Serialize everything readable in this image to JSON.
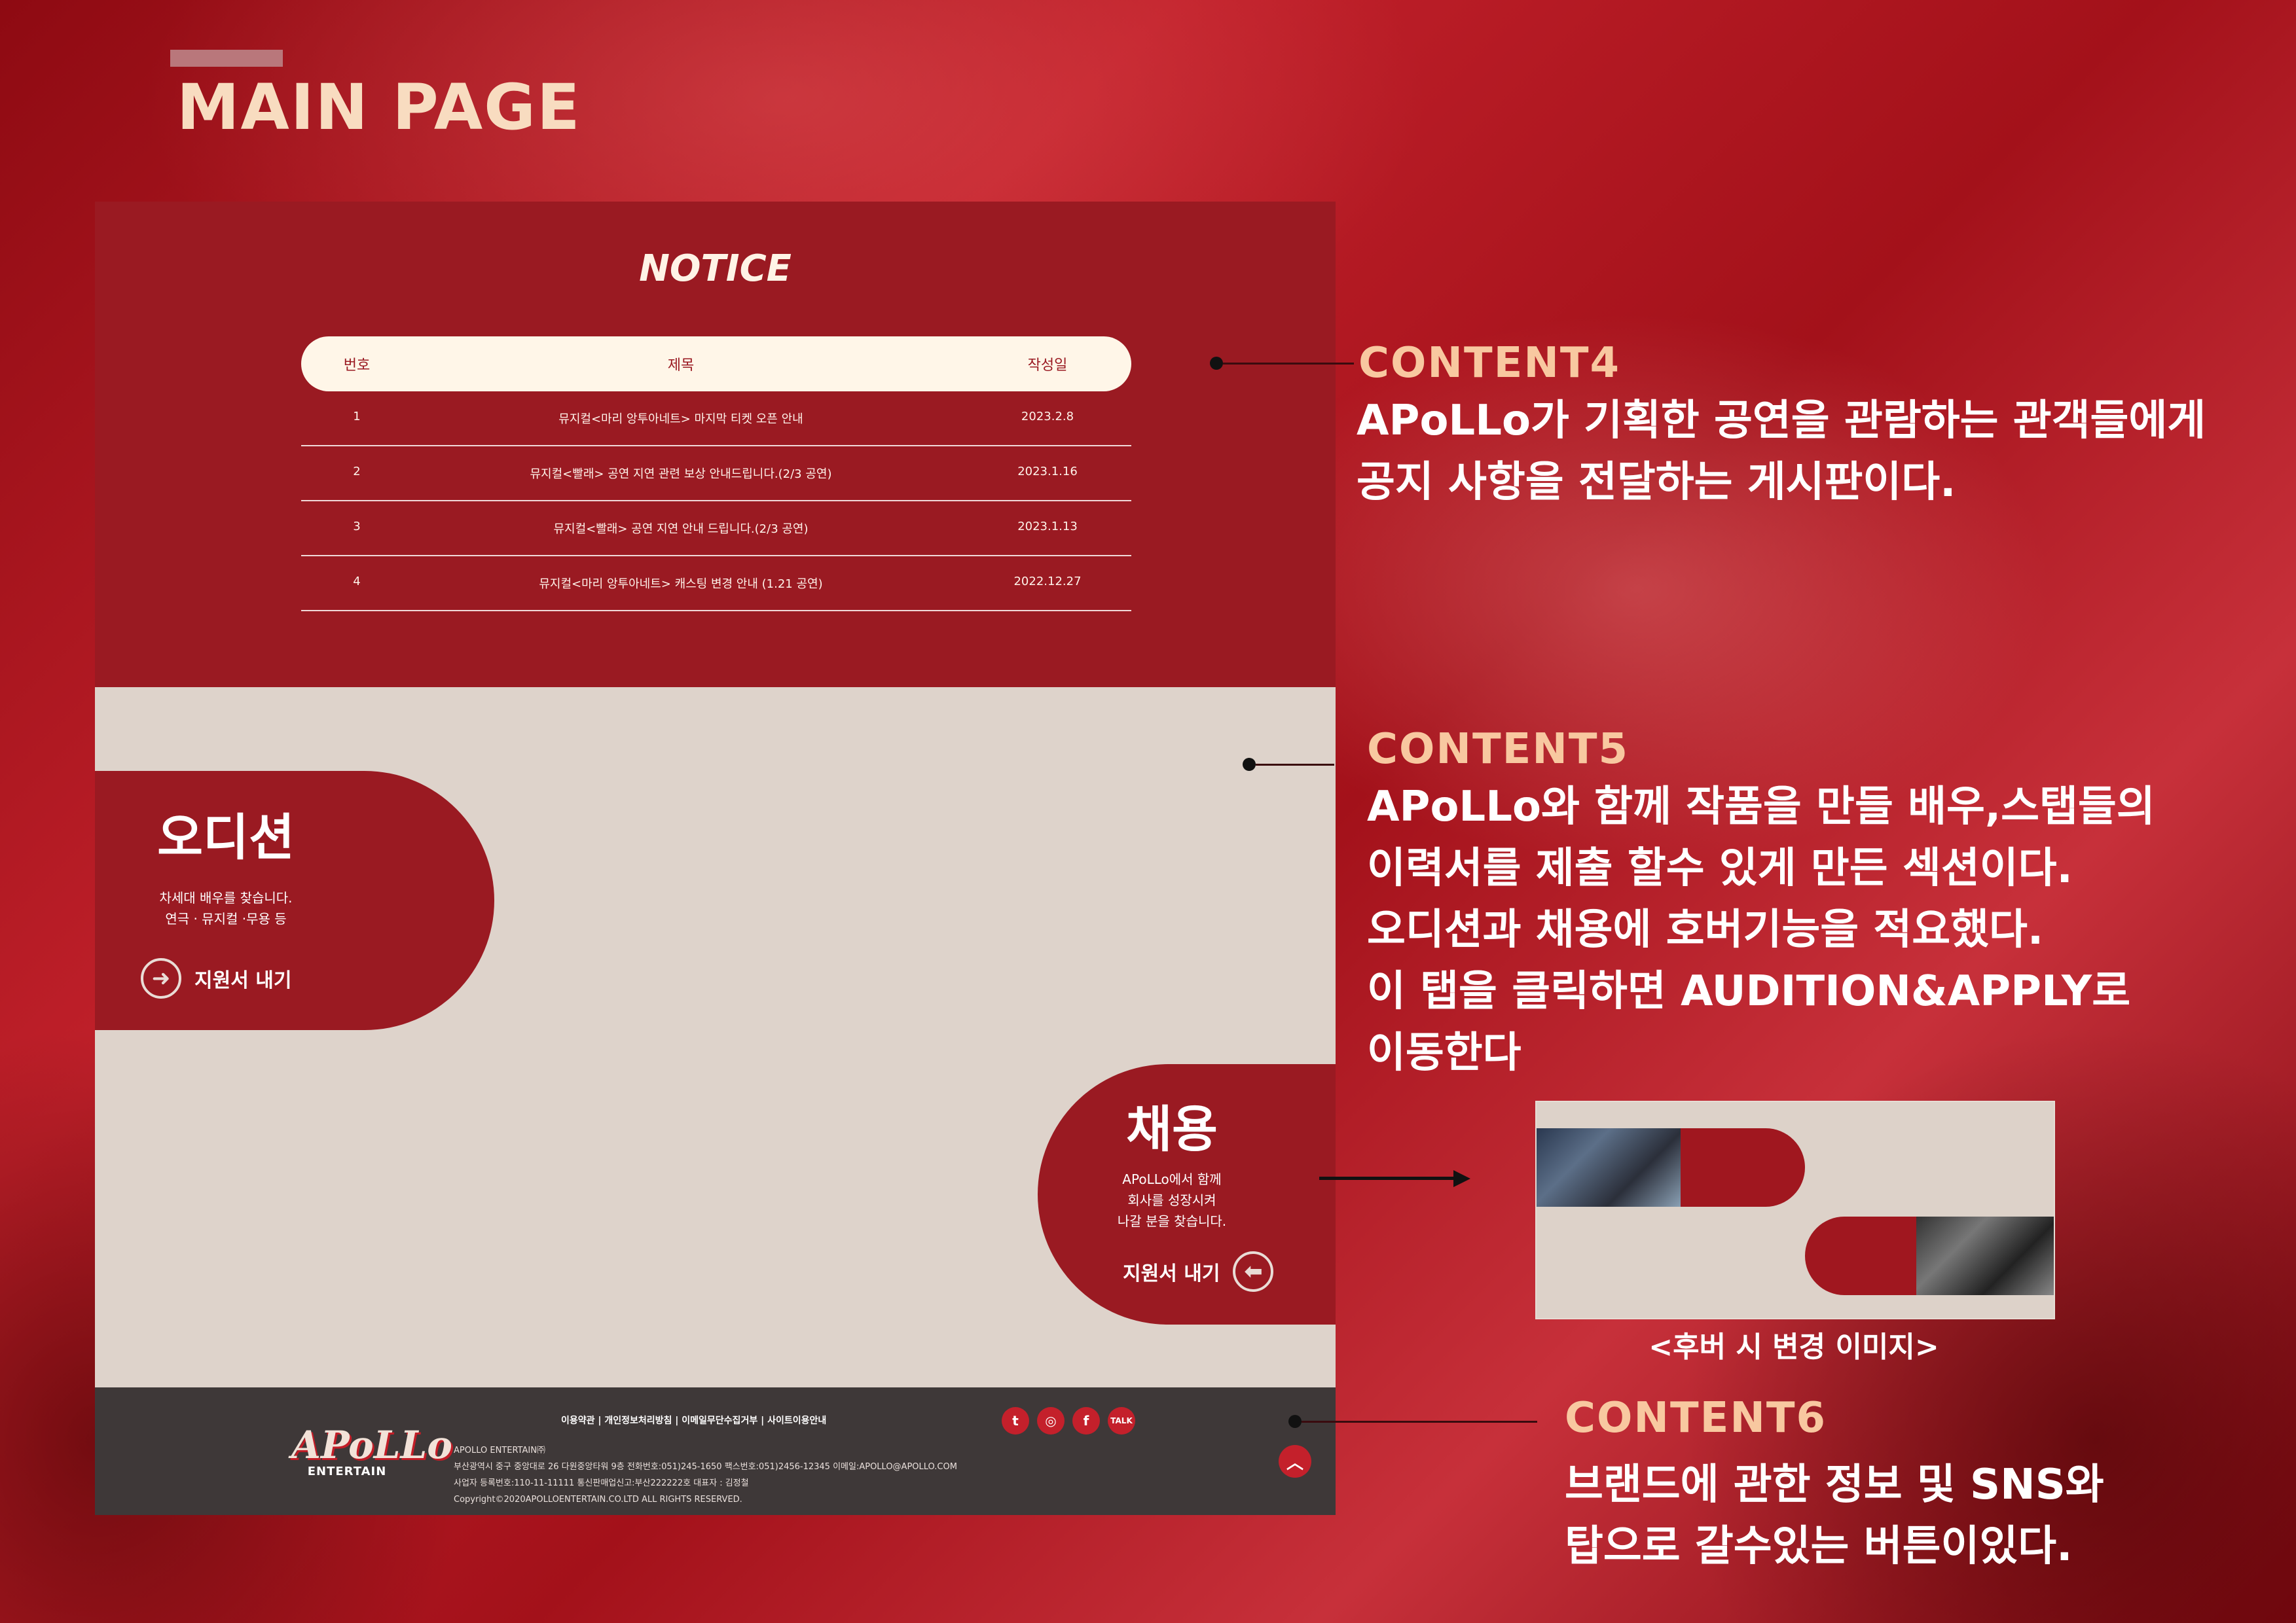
{
  "header": {
    "title": "MAIN PAGE"
  },
  "notice": {
    "title": "NOTICE",
    "columns": [
      "번호",
      "제목",
      "작성일"
    ],
    "rows": [
      {
        "no": "1",
        "title": "뮤지컬<마리 앙투아네트> 마지막 티켓 오픈 안내",
        "date": "2023.2.8"
      },
      {
        "no": "2",
        "title": "뮤지컬<빨래> 공연 지연 관련 보상 안내드립니다.(2/3 공연)",
        "date": "2023.1.16"
      },
      {
        "no": "3",
        "title": "뮤지컬<빨래> 공연 지연 안내 드립니다.(2/3 공연)",
        "date": "2023.1.13"
      },
      {
        "no": "4",
        "title": "뮤지컬<마리 앙투아네트> 캐스팅 변경 안내 (1.21 공연)",
        "date": "2022.12.27"
      }
    ]
  },
  "audition": {
    "title": "오디션",
    "desc_line1": "차세대 배우를 찾습니다.",
    "desc_line2": "연극 · 뮤지컬 ·무용 등",
    "apply_label": "지원서 내기",
    "icon": "arrow-right-icon"
  },
  "recruit": {
    "title": "채용",
    "desc_line1": "APoLLo에서 함께",
    "desc_line2": "회사를 성장시켜",
    "desc_line3": "나갈 분을 찾습니다.",
    "apply_label": "지원서 내기",
    "icon": "arrow-left-icon"
  },
  "footer": {
    "links": "이용약관  |  개인정보처리방침  |  이메일무단수집거부  |  사이트이용안내",
    "logo_main": "APoLLo",
    "logo_sub": "ENTERTAIN",
    "company": "APOLLO ENTERTAIN㈜",
    "address": "부산광역시 중구 중앙대로 26 다원중앙타워 9층 전화번호:051)245-1650 팩스번호:051)2456-12345 이메일:APOLLO@APOLLO.COM",
    "registration": "사업자 등록번호:110-11-11111 통신판매업신고:부산222222호 대표자 : 김정철",
    "copyright": "Copyright©2020APOLLOENTERTAIN.CO.LTD ALL RIGHTS RESERVED.",
    "sns": [
      "twitter-icon",
      "instagram-icon",
      "facebook-icon",
      "kakaotalk-icon"
    ],
    "top_icon": "chevron-up-icon"
  },
  "annotations": {
    "content4": {
      "heading": "CONTENT4",
      "line1": "APoLLo가 기획한 공연을 관람하는 관객들에게",
      "line2": "공지 사항을 전달하는 게시판이다."
    },
    "content5": {
      "heading": "CONTENT5",
      "line1": "APoLLo와 함께 작품을 만들 배우,스탭들의",
      "line2": "이력서를 제출 할수 있게 만든 섹션이다.",
      "line3": "오디션과 채용에 호버기능을 적요했다.",
      "line4": "이 탭을 클릭하면 AUDITION&APPLY로",
      "line5": "이동한다"
    },
    "hover_caption": "<후버 시 변경 이미지>",
    "content6": {
      "heading": "CONTENT6",
      "line1": "브랜드에 관한 정보 및 SNS와",
      "line2": "탑으로 갈수있는 버튼이있다."
    }
  },
  "colors": {
    "brand_red": "#9a1a22",
    "cream": "#fff6e8",
    "accent_heading": "#f8c8a0",
    "footer_bg": "#3e3838"
  }
}
